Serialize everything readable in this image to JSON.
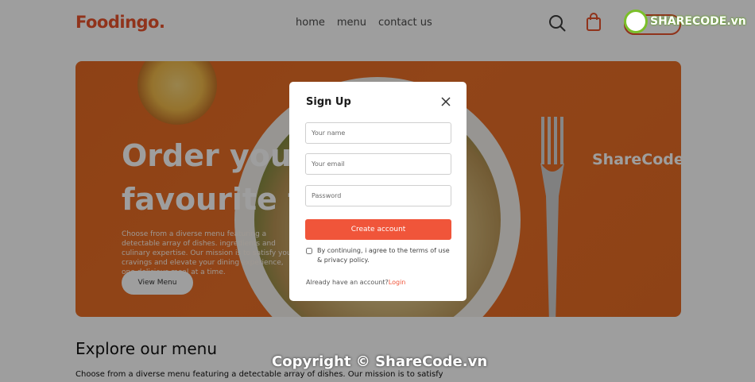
{
  "header": {
    "logo": "Foodingo.",
    "nav": [
      "home",
      "menu",
      "contact us"
    ]
  },
  "hero": {
    "title_line1": "Order your",
    "title_line2": "favourite fo",
    "description": "Choose from a diverse menu featuring a detectable array of dishes. ingredients and culinary expertise. Our mission is to satisfy your cravings and elevate your dining experience, one delicious meal at a time.",
    "button": "View Menu"
  },
  "explore": {
    "title": "Explore our menu",
    "text": "Choose from a diverse menu featuring a detectable array of dishes. Our mission is to satisfy"
  },
  "watermarks": {
    "hero": "ShareCode.vn",
    "copyright": "Copyright © ShareCode.vn",
    "logo": "SHARECODE.vn"
  },
  "modal": {
    "title": "Sign Up",
    "name_placeholder": "Your name",
    "email_placeholder": "Your email",
    "password_placeholder": "Password",
    "submit": "Create account",
    "terms": "By continuing, i agree to the terms of use & privacy policy.",
    "have_account": "Already have an account?",
    "login": "Login"
  },
  "colors": {
    "brand": "#e8532c",
    "button": "#f0553a"
  },
  "icons": [
    "search-icon",
    "shopping-bag-icon",
    "close-icon",
    "sharecode-logo-icon"
  ]
}
